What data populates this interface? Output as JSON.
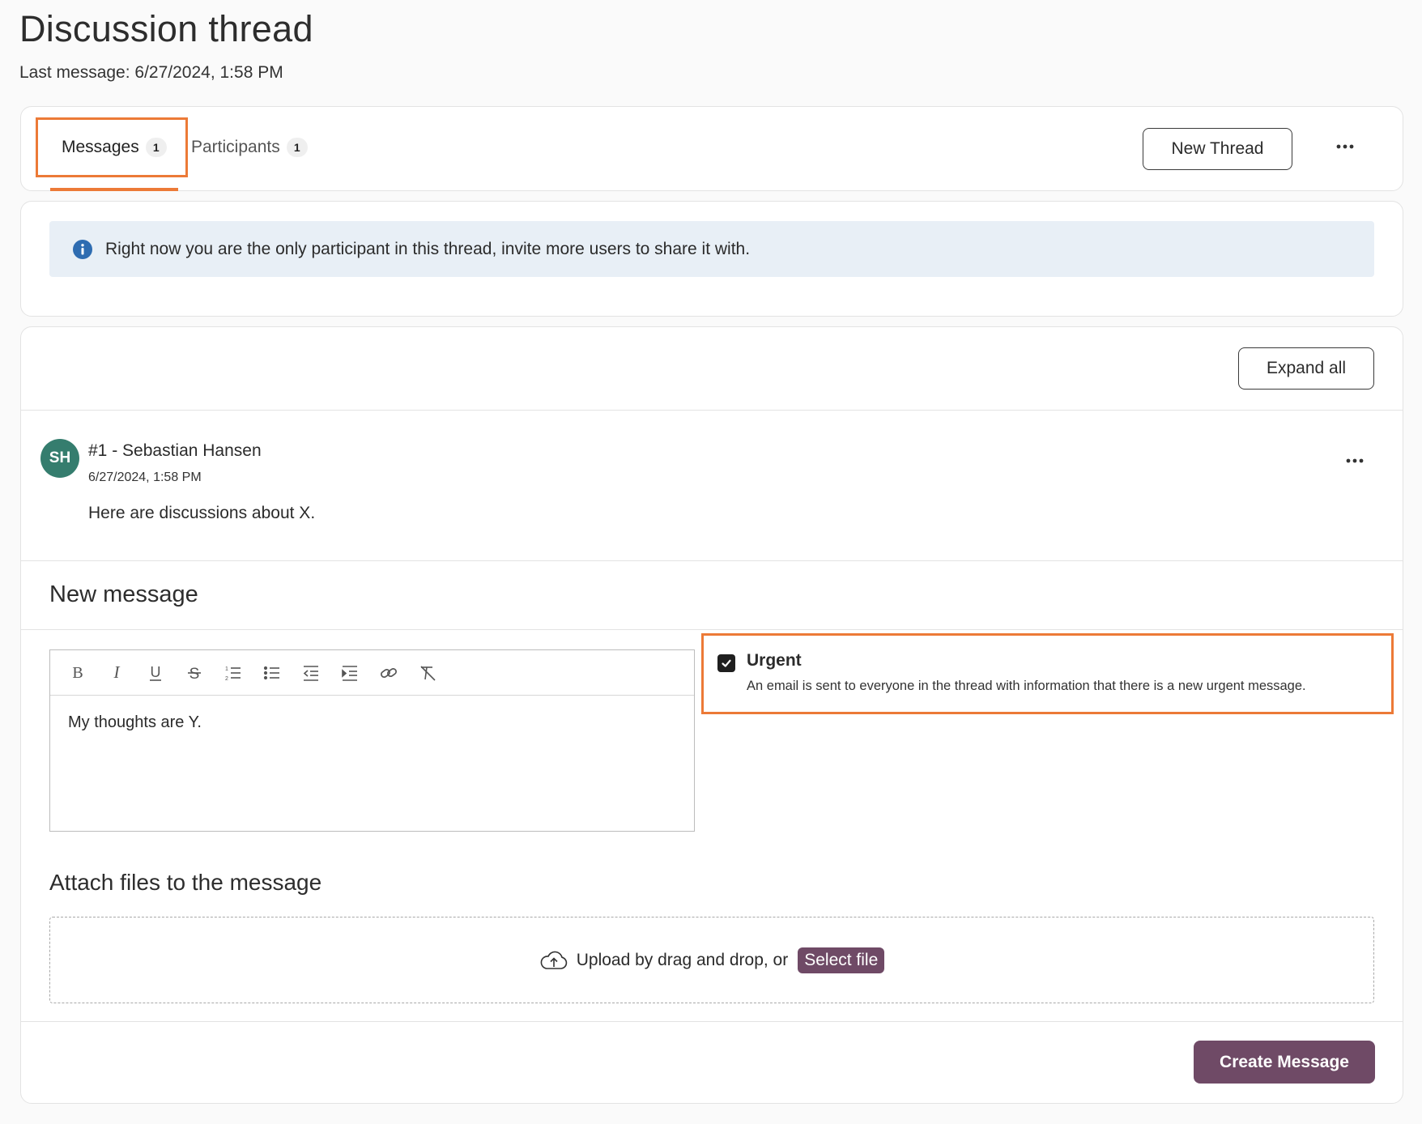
{
  "page": {
    "title": "Discussion thread",
    "last_message": "Last message: 6/27/2024, 1:58 PM"
  },
  "tabs": [
    {
      "label": "Messages",
      "count": "1",
      "active": true
    },
    {
      "label": "Participants",
      "count": "1",
      "active": false
    }
  ],
  "header_actions": {
    "new_thread_label": "New Thread",
    "more_icon": "more-horizontal-icon"
  },
  "info": {
    "icon": "info-icon",
    "text": "Right now you are the only participant in this thread, invite more users to share it with."
  },
  "messages_panel": {
    "expand_all_label": "Expand all",
    "messages": [
      {
        "avatar_initials": "SH",
        "author": "#1 - Sebastian Hansen",
        "timestamp": "6/27/2024, 1:58 PM",
        "body": "Here are discussions about X."
      }
    ]
  },
  "new_message": {
    "heading": "New message",
    "toolbar": [
      "bold-icon",
      "italic-icon",
      "underline-icon",
      "strikethrough-icon",
      "ordered-list-icon",
      "bullet-list-icon",
      "outdent-icon",
      "indent-icon",
      "link-icon",
      "clear-format-icon"
    ],
    "editor_content": "My thoughts are Y.",
    "urgent": {
      "checked": true,
      "label": "Urgent",
      "description": "An email is sent to everyone in the thread with information that there is a new urgent message."
    }
  },
  "attachments": {
    "heading": "Attach files to the message",
    "upload_text": "Upload by drag and drop, or",
    "select_file_label": "Select file"
  },
  "footer": {
    "create_label": "Create Message"
  },
  "colors": {
    "accent": "#ec7a37",
    "primary": "#6f4a66",
    "avatar": "#357d6e",
    "info_bg": "#e8eff6"
  }
}
